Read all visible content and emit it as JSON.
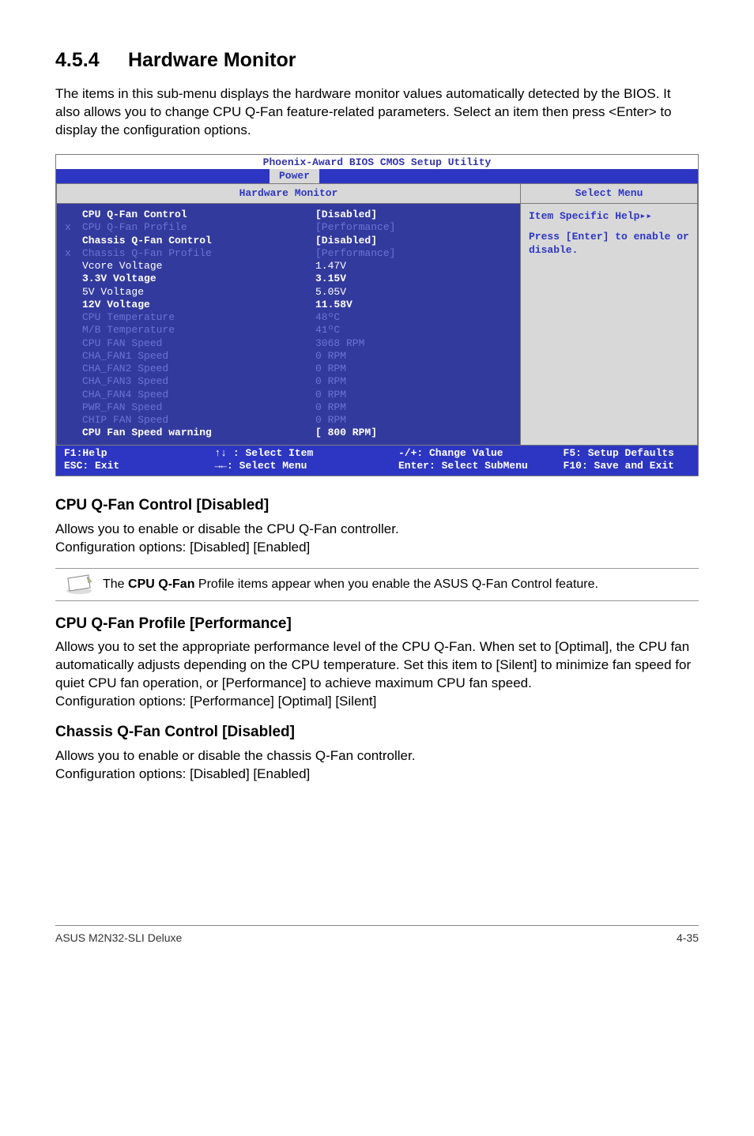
{
  "section": {
    "number": "4.5.4",
    "title": "Hardware Monitor"
  },
  "intro": "The items in this sub-menu displays the hardware monitor values automatically detected by the BIOS. It also allows you to change CPU Q-Fan feature-related parameters. Select an item then press <Enter> to display the configuration options.",
  "bios": {
    "title": "Phoenix-Award BIOS CMOS Setup Utility",
    "active_tab": "Power",
    "left_panel_title": "Hardware Monitor",
    "right_panel_title": "Select Menu",
    "help_title": "Item Specific Help▸▸",
    "help_text": "Press [Enter] to enable or disable.",
    "rows": [
      {
        "marker": "",
        "label": "CPU Q-Fan Control",
        "value": "[Disabled]",
        "dim": false,
        "bold": true
      },
      {
        "marker": "x",
        "label": "CPU Q-Fan Profile",
        "value": "[Performance]",
        "dim": true,
        "bold": false
      },
      {
        "marker": "",
        "label": "Chassis Q-Fan Control",
        "value": "[Disabled]",
        "dim": false,
        "bold": true
      },
      {
        "marker": "x",
        "label": "Chassis Q-Fan Profile",
        "value": "[Performance]",
        "dim": true,
        "bold": false
      },
      {
        "marker": "",
        "label": "Vcore Voltage",
        "value": "  1.47V",
        "dim": false,
        "bold": false
      },
      {
        "marker": "",
        "label": "3.3V Voltage",
        "value": "  3.15V",
        "dim": false,
        "bold": true
      },
      {
        "marker": "",
        "label": "5V Voltage",
        "value": "  5.05V",
        "dim": false,
        "bold": false
      },
      {
        "marker": "",
        "label": "12V Voltage",
        "value": " 11.58V",
        "dim": false,
        "bold": true
      },
      {
        "marker": "",
        "label": "",
        "value": "",
        "dim": false,
        "bold": false
      },
      {
        "marker": "",
        "label": "CPU Temperature",
        "value": "   48ºC",
        "dim": true,
        "bold": false
      },
      {
        "marker": "",
        "label": "M/B Temperature",
        "value": "   41ºC",
        "dim": true,
        "bold": false
      },
      {
        "marker": "",
        "label": "CPU FAN Speed",
        "value": " 3068 RPM",
        "dim": true,
        "bold": false
      },
      {
        "marker": "",
        "label": "CHA_FAN1 Speed",
        "value": "    0 RPM",
        "dim": true,
        "bold": false
      },
      {
        "marker": "",
        "label": "CHA_FAN2 Speed",
        "value": "    0 RPM",
        "dim": true,
        "bold": false
      },
      {
        "marker": "",
        "label": "CHA_FAN3 Speed",
        "value": "    0 RPM",
        "dim": true,
        "bold": false
      },
      {
        "marker": "",
        "label": "CHA_FAN4 Speed",
        "value": "    0 RPM",
        "dim": true,
        "bold": false
      },
      {
        "marker": "",
        "label": "PWR_FAN Speed",
        "value": "    0 RPM",
        "dim": true,
        "bold": false
      },
      {
        "marker": "",
        "label": "CHIP FAN Speed",
        "value": "    0 RPM",
        "dim": true,
        "bold": false
      },
      {
        "marker": "",
        "label": "CPU Fan Speed warning",
        "value": "[ 800 RPM]",
        "dim": false,
        "bold": true
      }
    ],
    "footer": {
      "f1": "F1:Help",
      "sel_item": "↑↓ : Select Item",
      "esc": "ESC: Exit",
      "sel_menu": "→←: Select Menu",
      "change": "-/+: Change Value",
      "enter": "Enter: Select SubMenu",
      "f5": "F5: Setup Defaults",
      "f10": "F10: Save and Exit"
    }
  },
  "sub1": {
    "heading": "CPU Q-Fan Control [Disabled]",
    "p1": "Allows you to enable or disable the CPU Q-Fan controller.",
    "p2": "Configuration options: [Disabled] [Enabled]"
  },
  "note": {
    "prefix": "The ",
    "bold": "CPU Q-Fan",
    "suffix": " Profile items appear when you enable the ASUS Q-Fan Control feature."
  },
  "sub2": {
    "heading": "CPU Q-Fan Profile [Performance]",
    "text": "Allows you to set the appropriate performance level of the CPU Q-Fan. When set to [Optimal], the CPU fan automatically adjusts depending on the CPU temperature. Set this item to [Silent] to minimize fan speed for quiet CPU fan operation, or [Performance] to achieve maximum CPU fan speed.",
    "cfg": "Configuration options: [Performance] [Optimal] [Silent]"
  },
  "sub3": {
    "heading": "Chassis Q-Fan Control [Disabled]",
    "p1": "Allows you to enable or disable the chassis Q-Fan controller.",
    "p2": "Configuration options: [Disabled] [Enabled]"
  },
  "footer": {
    "left": "ASUS M2N32-SLI Deluxe",
    "right": "4-35"
  }
}
